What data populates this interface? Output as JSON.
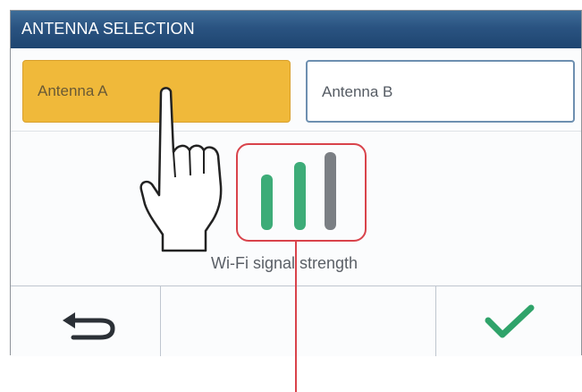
{
  "screen": {
    "title": "ANTENNA SELECTION"
  },
  "antennas": [
    {
      "label": "Antenna A",
      "selected": true
    },
    {
      "label": "Antenna B",
      "selected": false
    }
  ],
  "signal": {
    "label": "Wi-Fi signal strength",
    "bars_total": 3,
    "bars_active": 2,
    "active_color": "#3dac78",
    "inactive_color": "#7b7f84"
  },
  "footer": {
    "back_icon": "back-arrow-icon",
    "confirm_icon": "checkmark-icon"
  },
  "colors": {
    "titlebar": "#2a5381",
    "selected_button": "#f0b93a",
    "callout": "#d9434b",
    "check": "#2fa36a"
  }
}
